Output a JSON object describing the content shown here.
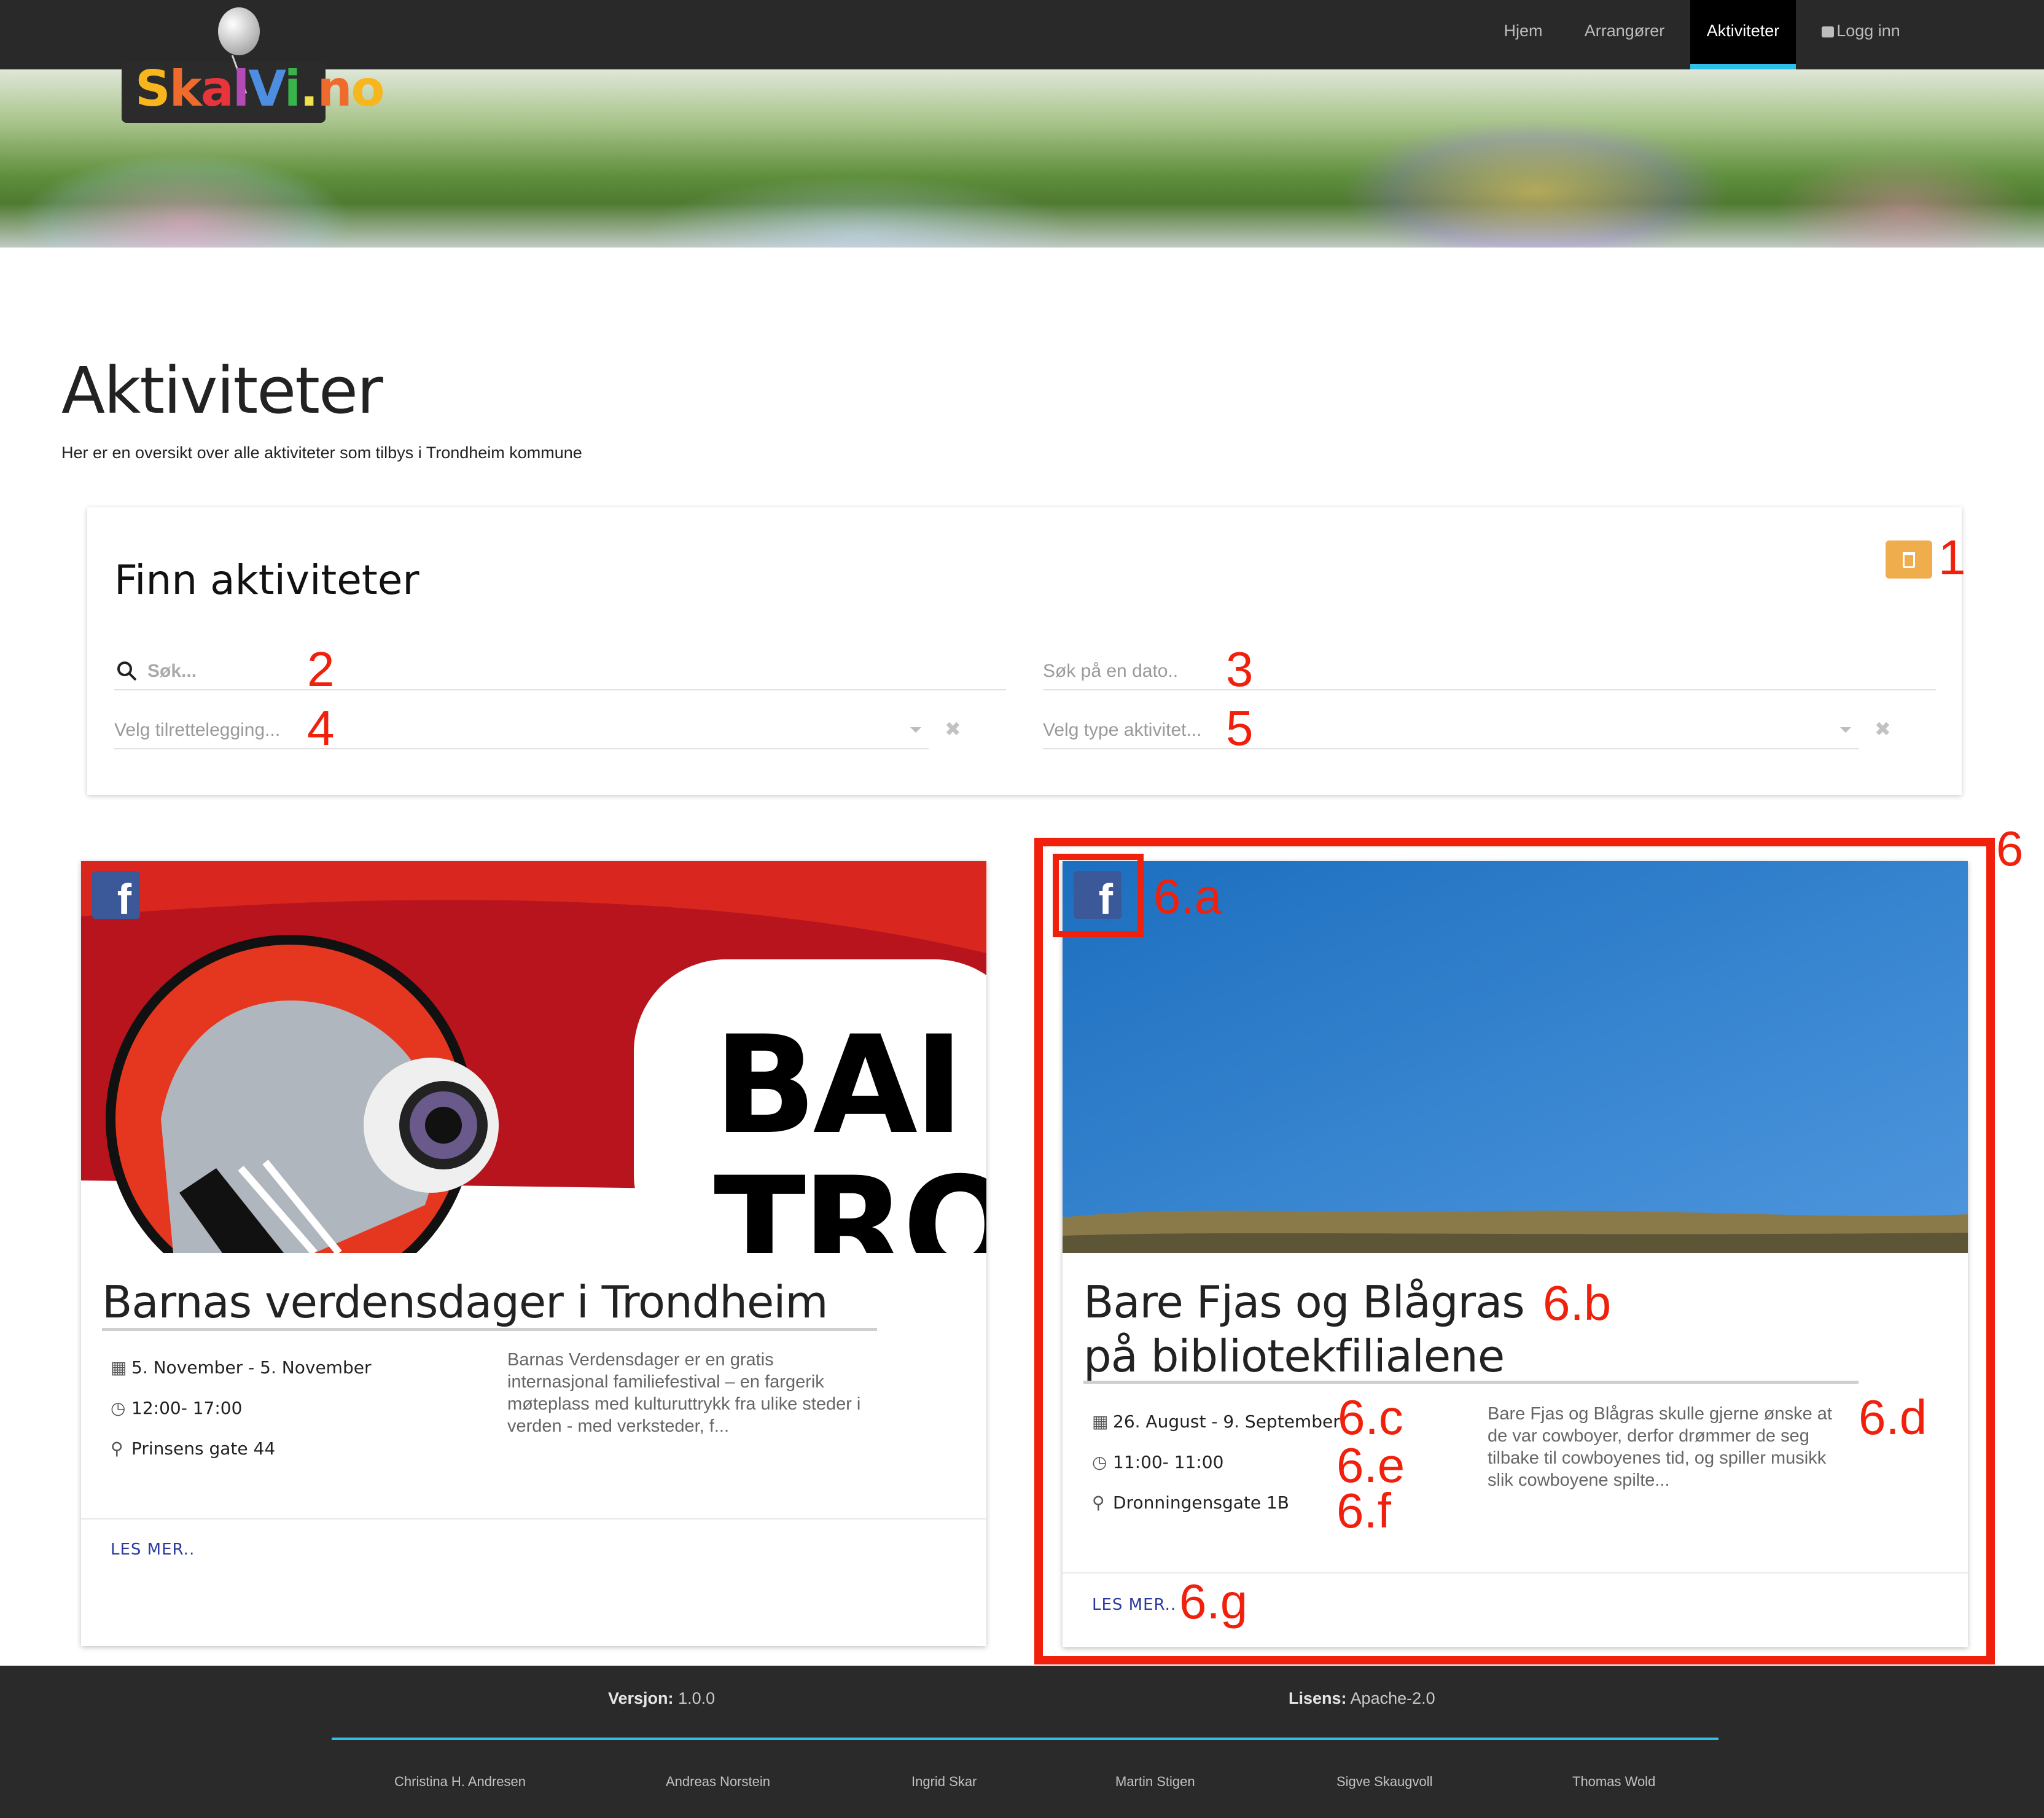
{
  "nav": {
    "items": [
      {
        "label": "Hjem"
      },
      {
        "label": "Arrangører"
      },
      {
        "label": "Aktiviteter"
      },
      {
        "label": "Logg inn"
      }
    ],
    "active": "Aktiviteter"
  },
  "logo": {
    "text": "SkalVi.no"
  },
  "page": {
    "title": "Aktiviteter",
    "subtitle": "Her er en oversikt over alle aktiviteter som tilbys i Trondheim kommune"
  },
  "search": {
    "title": "Finn aktiviteter",
    "query_placeholder": "Søk...",
    "date_placeholder": "Søk på en dato..",
    "facilitation_placeholder": "Velg tilrettelegging...",
    "type_placeholder": "Velg type aktivitet..."
  },
  "cards": [
    {
      "title": "Barnas verdensdager i Trondheim",
      "date": "5. November - 5. November",
      "time": "12:00- 17:00",
      "location": "Prinsens gate 44",
      "description": "Barnas Verdensdager er en gratis internasjonal familiefestival – en fargerik møteplass med kulturuttrykk fra ulike steder i verden - med verksteder, f...",
      "read_more": "LES MER..",
      "image_text": "BAI TRO"
    },
    {
      "title": "Bare Fjas og Blågras på bibliotekfilialene",
      "date": "26. August - 9. September",
      "time": "11:00- 11:00",
      "location": "Dronningensgate 1B",
      "description": "Bare Fjas og Blågras skulle gjerne ønske at de var cowboyer, derfor drømmer de seg tilbake til cowboyenes tid, og spiller musikk slik cowboyene spilte...",
      "read_more": "LES MER.."
    }
  ],
  "annotations": [
    "1",
    "2",
    "3",
    "4",
    "5",
    "6",
    "6.a",
    "6.b",
    "6.c",
    "6.d",
    "6.e",
    "6.f",
    "6.g"
  ],
  "footer": {
    "version_label": "Versjon:",
    "version": "1.0.0",
    "license_label": "Lisens:",
    "license": "Apache-2.0",
    "names": [
      "Christina H. Andresen",
      "Andreas Norstein",
      "Ingrid Skar",
      "Martin Stigen",
      "Sigve Skaugvoll",
      "Thomas Wold"
    ]
  },
  "colors": {
    "topbar": "#292929",
    "nav_active_border": "#30bde8",
    "annotation": "#f0200c",
    "clear_button": "#f0ad4e",
    "facebook": "#3b5998",
    "link": "#2b3a9e"
  },
  "icons": [
    "trash-icon",
    "search-icon",
    "calendar-icon",
    "clock-icon",
    "map-marker-icon",
    "facebook-icon",
    "lock-icon"
  ]
}
